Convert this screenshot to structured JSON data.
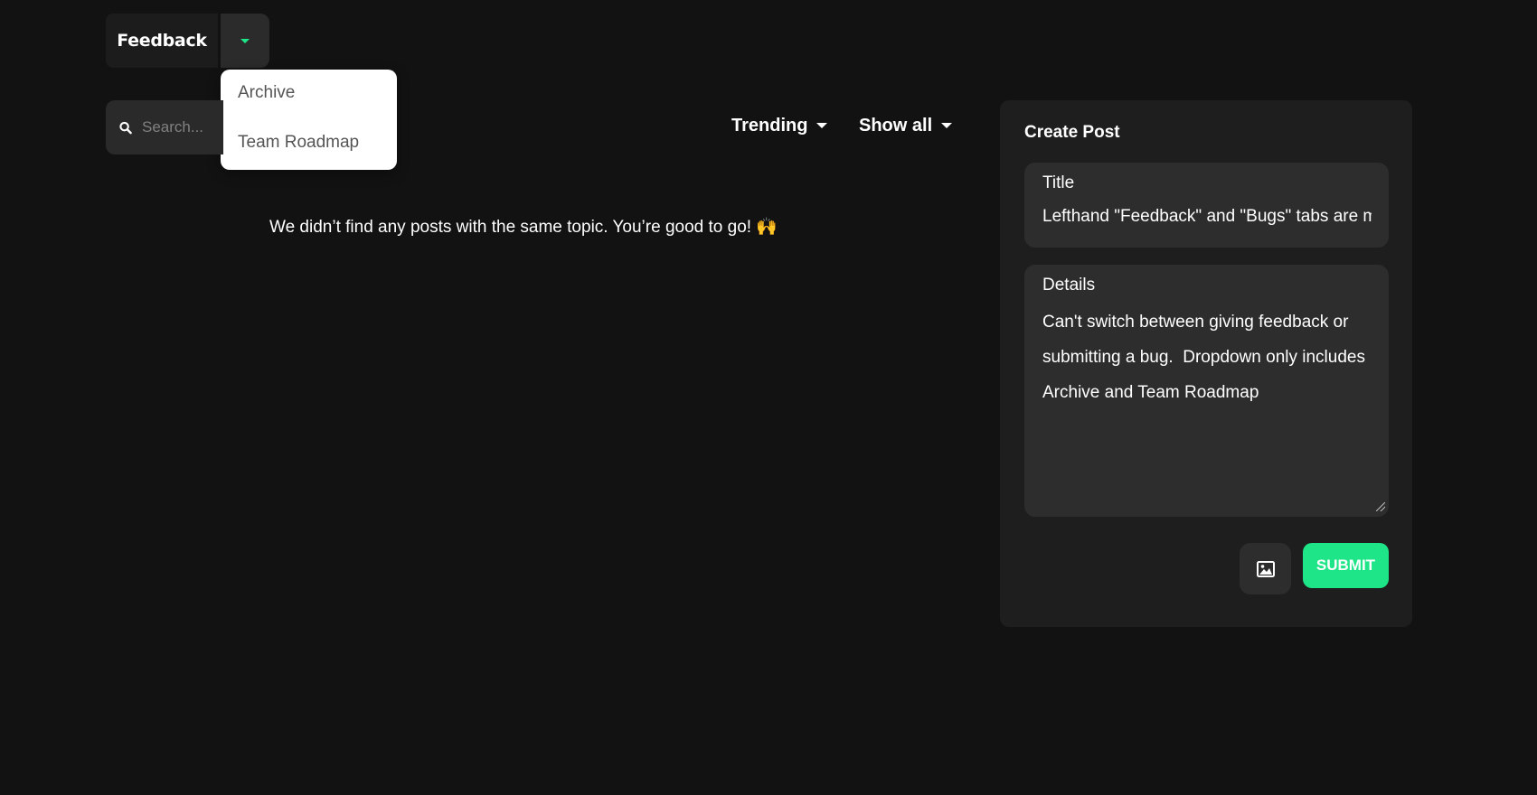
{
  "board": {
    "current": "Feedback",
    "menu_items": [
      {
        "label": "Archive"
      },
      {
        "label": "Team Roadmap"
      }
    ]
  },
  "search": {
    "placeholder": "Search...",
    "value": ""
  },
  "toolbar": {
    "sort_label": "Trending",
    "filter_label": "Show all"
  },
  "empty_state": {
    "message": "We didn’t find any posts with the same topic. You’re good to go! 🙌"
  },
  "create_post": {
    "heading": "Create Post",
    "title_label": "Title",
    "title_value": "Lefthand \"Feedback\" and \"Bugs\" tabs are missing",
    "details_label": "Details",
    "details_value": "Can't switch between giving feedback or submitting a bug.  Dropdown only includes Archive and Team Roadmap",
    "submit_label": "SUBMIT"
  },
  "colors": {
    "background": "#121212",
    "accent": "#1ee688",
    "panel": "#1e1e1e",
    "field": "#2d2d2d"
  },
  "icons": {
    "search": "search-icon",
    "image": "image-icon",
    "dropdown": "chevron-down-icon"
  }
}
